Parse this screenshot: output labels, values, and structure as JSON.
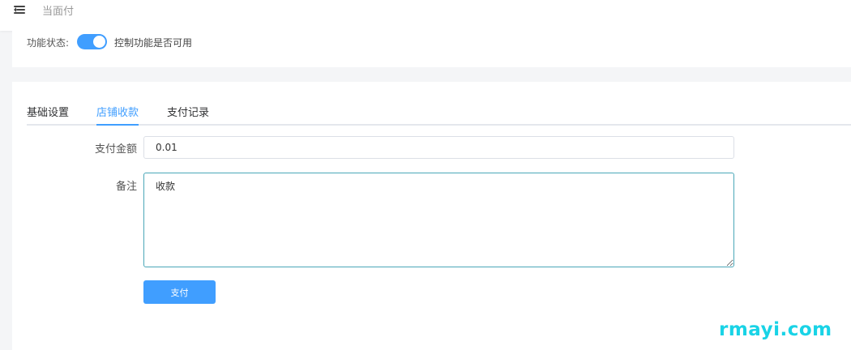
{
  "header": {
    "page_title": "当面付"
  },
  "status": {
    "label": "功能状态:",
    "enabled": true,
    "description": "控制功能是否可用"
  },
  "tabs": [
    {
      "label": "基础设置",
      "active": false
    },
    {
      "label": "店铺收款",
      "active": true
    },
    {
      "label": "支付记录",
      "active": false
    }
  ],
  "form": {
    "amount_label": "支付金额",
    "amount_value": "0.01",
    "note_label": "备注",
    "note_value": "收款",
    "submit_label": "支付"
  },
  "watermark": {
    "text": "rmayi.com"
  },
  "colors": {
    "accent": "#409eff",
    "watermark": "#19d3e6"
  }
}
